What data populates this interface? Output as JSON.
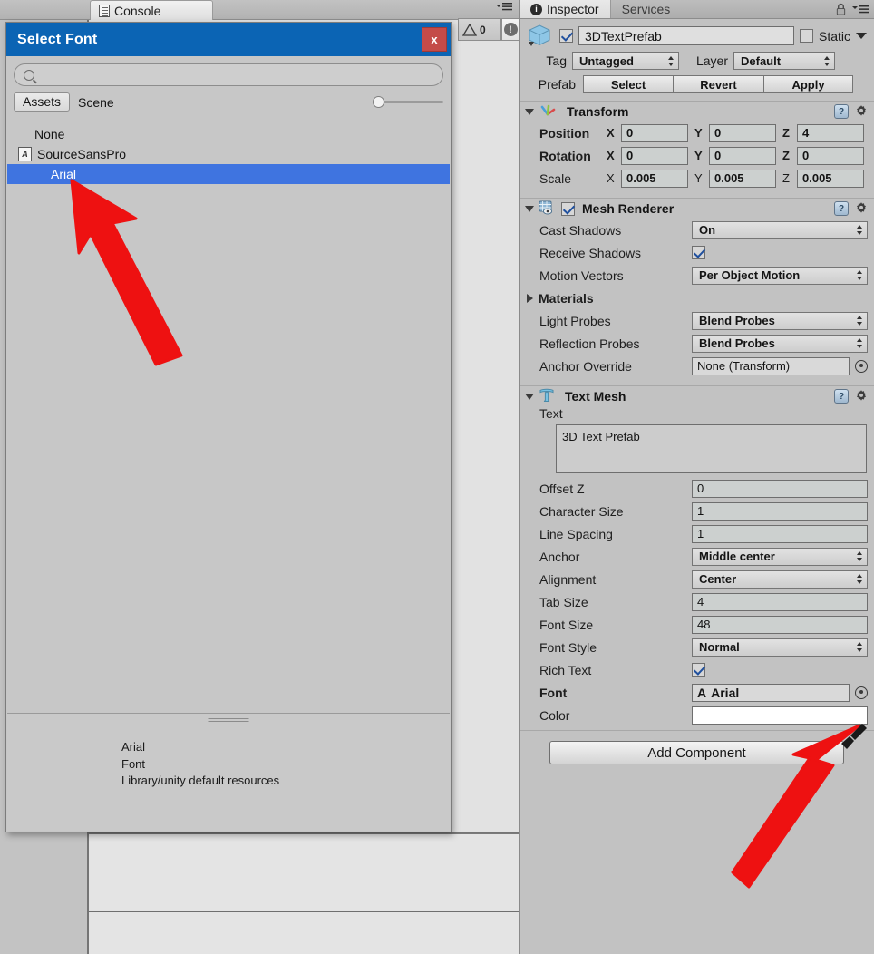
{
  "toolbar": {
    "console_tab": "Console",
    "lock_icon": "lock-icon",
    "menu_icon": "hamburger-menu-icon",
    "warning_count": "0",
    "error_count": ""
  },
  "dialog": {
    "title": "Select Font",
    "close_label": "x",
    "search_placeholder": "",
    "search_value": "",
    "tabs": [
      {
        "label": "Assets",
        "active": true
      },
      {
        "label": "Scene",
        "active": false
      }
    ],
    "items": [
      {
        "label": "None",
        "icon": "",
        "selected": false
      },
      {
        "label": "SourceSansPro",
        "icon": "A",
        "selected": false
      },
      {
        "label": "Arial",
        "icon": "",
        "selected": true
      }
    ],
    "preview": {
      "name": "Arial",
      "type": "Font",
      "path": "Library/unity default resources"
    }
  },
  "inspector": {
    "tabs": [
      {
        "label": "Inspector",
        "active": true
      },
      {
        "label": "Services",
        "active": false
      }
    ],
    "object": {
      "enabled": true,
      "name": "3DTextPrefab",
      "static_label": "Static",
      "static_checked": false,
      "tag_label": "Tag",
      "tag_value": "Untagged",
      "layer_label": "Layer",
      "layer_value": "Default",
      "prefab_label": "Prefab",
      "prefab_buttons": [
        "Select",
        "Revert",
        "Apply"
      ]
    },
    "transform": {
      "title": "Transform",
      "rows": [
        {
          "label": "Position",
          "bold": true,
          "x": "0",
          "y": "0",
          "z": "4"
        },
        {
          "label": "Rotation",
          "bold": true,
          "x": "0",
          "y": "0",
          "z": "0"
        },
        {
          "label": "Scale",
          "bold": false,
          "x": "0.005",
          "y": "0.005",
          "z": "0.005"
        }
      ],
      "axes": [
        "X",
        "Y",
        "Z"
      ]
    },
    "mesh_renderer": {
      "title": "Mesh Renderer",
      "enabled": true,
      "cast_shadows_label": "Cast Shadows",
      "cast_shadows_value": "On",
      "receive_shadows_label": "Receive Shadows",
      "receive_shadows_checked": true,
      "motion_vectors_label": "Motion Vectors",
      "motion_vectors_value": "Per Object Motion",
      "materials_label": "Materials",
      "light_probes_label": "Light Probes",
      "light_probes_value": "Blend Probes",
      "reflection_probes_label": "Reflection Probes",
      "reflection_probes_value": "Blend Probes",
      "anchor_override_label": "Anchor Override",
      "anchor_override_value": "None (Transform)"
    },
    "text_mesh": {
      "title": "Text Mesh",
      "text_label": "Text",
      "text_value": "3D Text Prefab",
      "offset_z_label": "Offset Z",
      "offset_z_value": "0",
      "character_size_label": "Character Size",
      "character_size_value": "1",
      "line_spacing_label": "Line Spacing",
      "line_spacing_value": "1",
      "anchor_label": "Anchor",
      "anchor_value": "Middle center",
      "alignment_label": "Alignment",
      "alignment_value": "Center",
      "tab_size_label": "Tab Size",
      "tab_size_value": "4",
      "font_size_label": "Font Size",
      "font_size_value": "48",
      "font_style_label": "Font Style",
      "font_style_value": "Normal",
      "rich_text_label": "Rich Text",
      "rich_text_checked": true,
      "font_label": "Font",
      "font_value": "Arial",
      "color_label": "Color",
      "color_value": "#FFFFFF"
    },
    "add_component_label": "Add Component"
  },
  "colors": {
    "dialog_title_bg": "#0b64b4",
    "selection_blue": "#3f74e0",
    "close_red": "#c44b49",
    "arrow_red": "#ee1111",
    "panel_bg": "#c2c2c2"
  }
}
